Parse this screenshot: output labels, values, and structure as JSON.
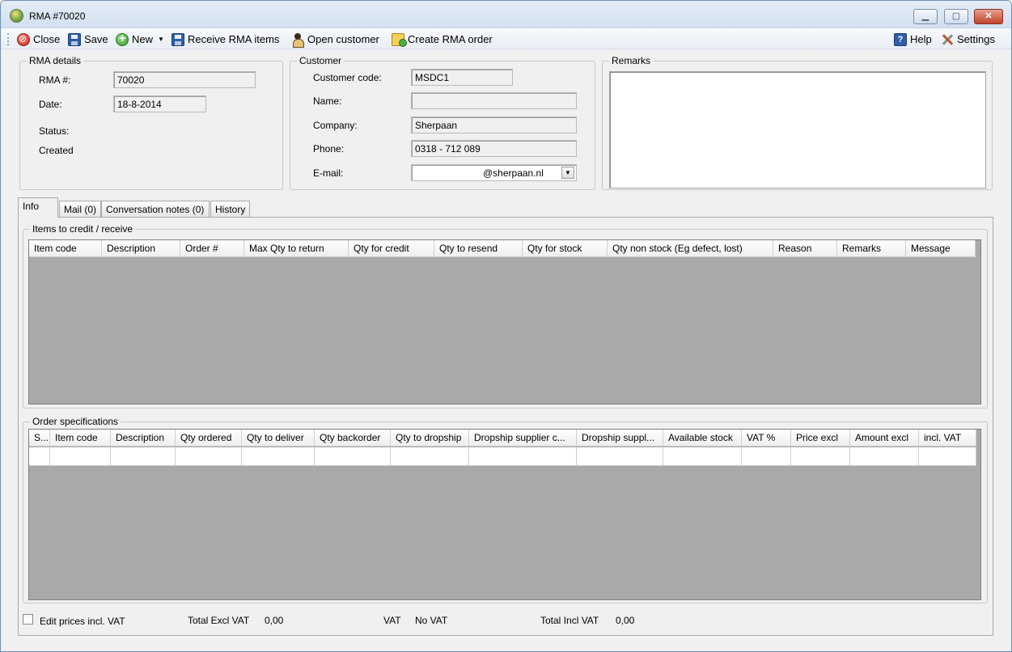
{
  "window": {
    "title": "RMA #70020",
    "minimize_icon": "minimize-icon",
    "maximize_icon": "maximize-icon",
    "close_icon": "close-icon"
  },
  "toolbar": {
    "close_label": "Close",
    "save_label": "Save",
    "new_label": "New",
    "receive_label": "Receive RMA items",
    "open_customer_label": "Open customer",
    "create_order_label": "Create RMA order",
    "help_label": "Help",
    "settings_label": "Settings"
  },
  "rma_details": {
    "legend": "RMA details",
    "rma_no_label": "RMA #:",
    "rma_no_value": "70020",
    "date_label": "Date:",
    "date_value": "18-8-2014",
    "status_label": "Status:",
    "status_value": "Created"
  },
  "customer": {
    "legend": "Customer",
    "code_label": "Customer code:",
    "code_value": "MSDC1",
    "name_label": "Name:",
    "name_value": "",
    "company_label": "Company:",
    "company_value": "Sherpaan",
    "phone_label": "Phone:",
    "phone_value": "0318 - 712 089",
    "email_label": "E-mail:",
    "email_value": "@sherpaan.nl"
  },
  "remarks": {
    "legend": "Remarks",
    "value": ""
  },
  "tabs": [
    {
      "label": "Info",
      "active": true
    },
    {
      "label": "Mail (0)",
      "active": false
    },
    {
      "label": "Conversation notes (0)",
      "active": false
    },
    {
      "label": "History",
      "active": false
    }
  ],
  "items_grid": {
    "legend": "Items to credit / receive",
    "columns": [
      "Item code",
      "Description",
      "Order #",
      "Max Qty to return",
      "Qty for credit",
      "Qty to resend",
      "Qty for stock",
      "Qty non stock (Eg defect, lost)",
      "Reason",
      "Remarks",
      "Message"
    ]
  },
  "order_grid": {
    "legend": "Order specifications",
    "columns": [
      "S...",
      "Item code",
      "Description",
      "Qty ordered",
      "Qty to deliver",
      "Qty backorder",
      "Qty to dropship",
      "Dropship supplier c...",
      "Dropship suppl...",
      "Available stock",
      "VAT %",
      "Price excl",
      "Amount excl",
      "incl. VAT"
    ]
  },
  "footer": {
    "edit_prices_label": "Edit prices incl. VAT",
    "total_excl_label": "Total Excl VAT",
    "total_excl_value": "0,00",
    "vat_label": "VAT",
    "vat_value": "No VAT",
    "total_incl_label": "Total Incl VAT",
    "total_incl_value": "0,00"
  }
}
